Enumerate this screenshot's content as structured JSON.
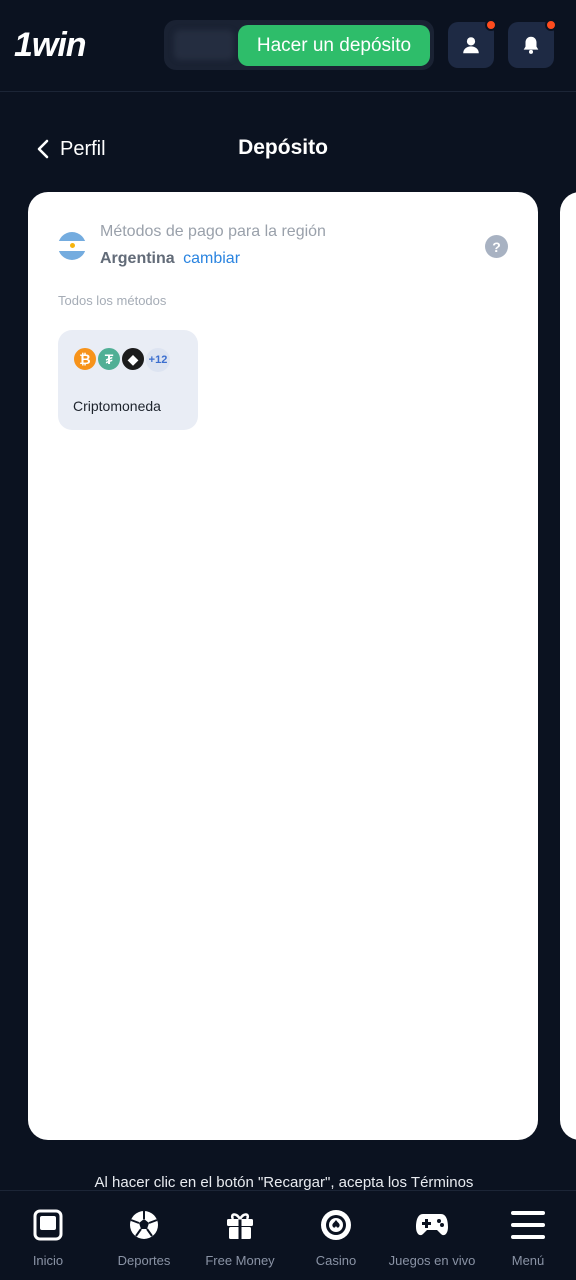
{
  "header": {
    "logo": "1win",
    "deposit_button": "Hacer un depósito",
    "icons": [
      "user-icon",
      "bell-icon"
    ],
    "accent_color": "#2ebd6a",
    "badge_color": "#ff4c1e"
  },
  "subheader": {
    "back_label": "Perfil",
    "title": "Depósito"
  },
  "region": {
    "label": "Métodos de pago para la región",
    "country": "Argentina",
    "change_link": "cambiar",
    "help": "?"
  },
  "methods": {
    "section_label": "Todos los métodos",
    "items": [
      {
        "name": "Criptomoneda",
        "coins": [
          "₿",
          "₮",
          "◆"
        ],
        "more": "+12"
      }
    ]
  },
  "terms_text": "Al hacer clic en el botón \"Recargar\", acepta los Términos",
  "bottom_nav": {
    "items": [
      {
        "label": "Inicio",
        "icon": "home-icon"
      },
      {
        "label": "Deportes",
        "icon": "soccer-ball-icon"
      },
      {
        "label": "Free Money",
        "icon": "gift-icon"
      },
      {
        "label": "Casino",
        "icon": "casino-chip-icon"
      },
      {
        "label": "Juegos en vivo",
        "icon": "gamepad-icon"
      },
      {
        "label": "Menú",
        "icon": "menu-icon"
      }
    ]
  }
}
